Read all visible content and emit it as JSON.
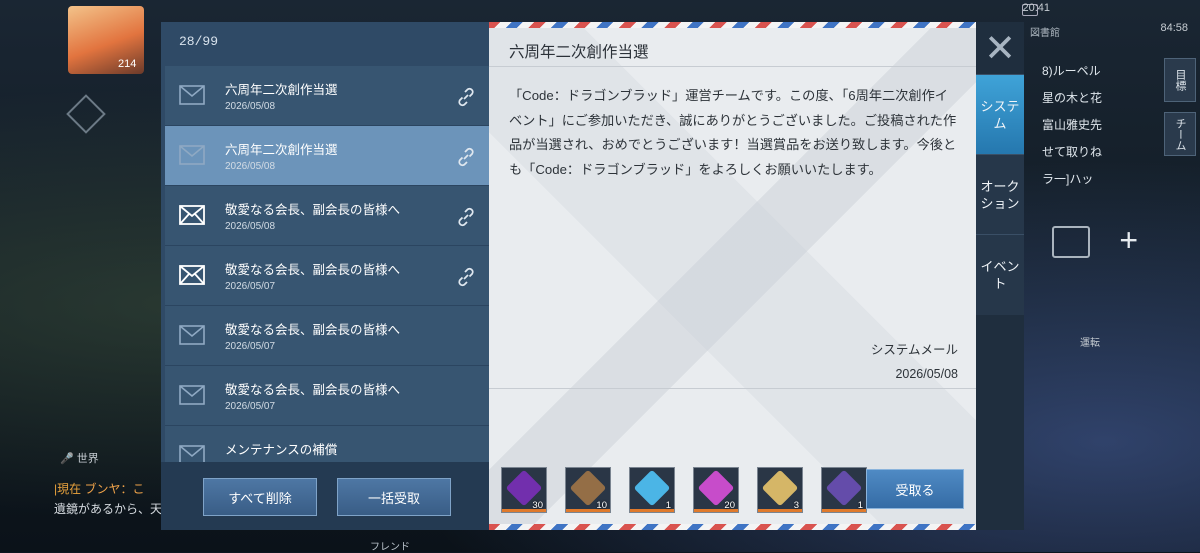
{
  "background": {
    "status_time": "20:41",
    "status_battery": "84:58",
    "zone_name": "図書館",
    "player_level": "214",
    "quest_lines": [
      "8)ルーペル",
      "星の木と花",
      "富山雅史先",
      "せて取りね",
      "ラ一]ハッ"
    ],
    "side_buttons": [
      "目標",
      "チーム"
    ],
    "rotate_label": "運転",
    "chat_tab": "世界",
    "chat_lines": [
      {
        "channel": "|現在",
        "name": "ブンヤ：こ",
        "text": ""
      },
      {
        "channel": "",
        "name": "",
        "text": "遺鏡があるから、天"
      }
    ],
    "friend_label": "フレンド"
  },
  "mail": {
    "count": "28/99",
    "items": [
      {
        "subject": "六周年二次創作当選",
        "date": "2026/05/08",
        "read": true,
        "has_link": true
      },
      {
        "subject": "六周年二次創作当選",
        "date": "2026/05/08",
        "read": true,
        "has_link": true
      },
      {
        "subject": "敬愛なる会長、副会長の皆様へ",
        "date": "2026/05/08",
        "read": false,
        "has_link": true
      },
      {
        "subject": "敬愛なる会長、副会長の皆様へ",
        "date": "2026/05/07",
        "read": false,
        "has_link": true
      },
      {
        "subject": "敬愛なる会長、副会長の皆様へ",
        "date": "2026/05/07",
        "read": true,
        "has_link": false
      },
      {
        "subject": "敬愛なる会長、副会長の皆様へ",
        "date": "2026/05/07",
        "read": true,
        "has_link": false
      },
      {
        "subject": "メンテナンスの補償",
        "date": "",
        "read": true,
        "has_link": false
      }
    ],
    "selected_index": 1,
    "delete_all_label": "すべて削除",
    "receive_all_label": "一括受取"
  },
  "detail": {
    "title": "六周年二次創作当選",
    "body": "「Code：ドラゴンブラッド」運営チームです。この度、「6周年二次創作イベント」にご参加いただき、誠にありがとうございました。ご投稿された作品が当選され、おめでとうございます！当選賞品をお送り致します。今後とも「Code：ドラゴンブラッド」をよろしくお願いいたします。",
    "sender": "システムメール",
    "date": "2026/05/08",
    "attachments": [
      {
        "icon": "purple-crystal-shard-icon",
        "qty": "30",
        "color": "#7a2fb8"
      },
      {
        "icon": "wooden-chest-icon",
        "qty": "10",
        "color": "#a07446"
      },
      {
        "icon": "diamond-icon",
        "qty": "1",
        "color": "#4fc3f7"
      },
      {
        "icon": "pink-crystal-icon",
        "qty": "20",
        "color": "#d84fd8"
      },
      {
        "icon": "rainbow-gem-icon",
        "qty": "3",
        "color": "#e8c46a"
      },
      {
        "icon": "purple-treasure-chest-icon",
        "qty": "1",
        "color": "#6a4fb5"
      }
    ],
    "receive_label": "受取る"
  },
  "tabs": {
    "close_icon": "close-x-icon",
    "items": [
      {
        "label": "システム",
        "active": true
      },
      {
        "label": "オーク\nション",
        "active": false
      },
      {
        "label": "イベント",
        "active": false
      }
    ]
  }
}
